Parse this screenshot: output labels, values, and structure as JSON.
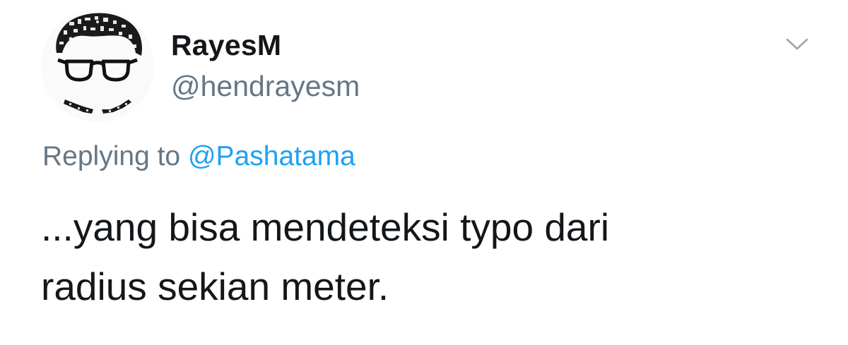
{
  "tweet": {
    "author": {
      "display_name": "RayesM",
      "handle": "@hendrayesm",
      "avatar_icon": "avatar-glasses-icon"
    },
    "reply": {
      "prefix": "Replying to",
      "mention": "@Pashatama"
    },
    "text": {
      "line1": "...yang bisa mendeteksi typo dari",
      "line2": "radius sekian meter."
    },
    "menu_icon": "chevron-down-icon"
  },
  "colors": {
    "text_primary": "#14171a",
    "text_secondary": "#657786",
    "link": "#1da1f2",
    "background": "#ffffff"
  }
}
